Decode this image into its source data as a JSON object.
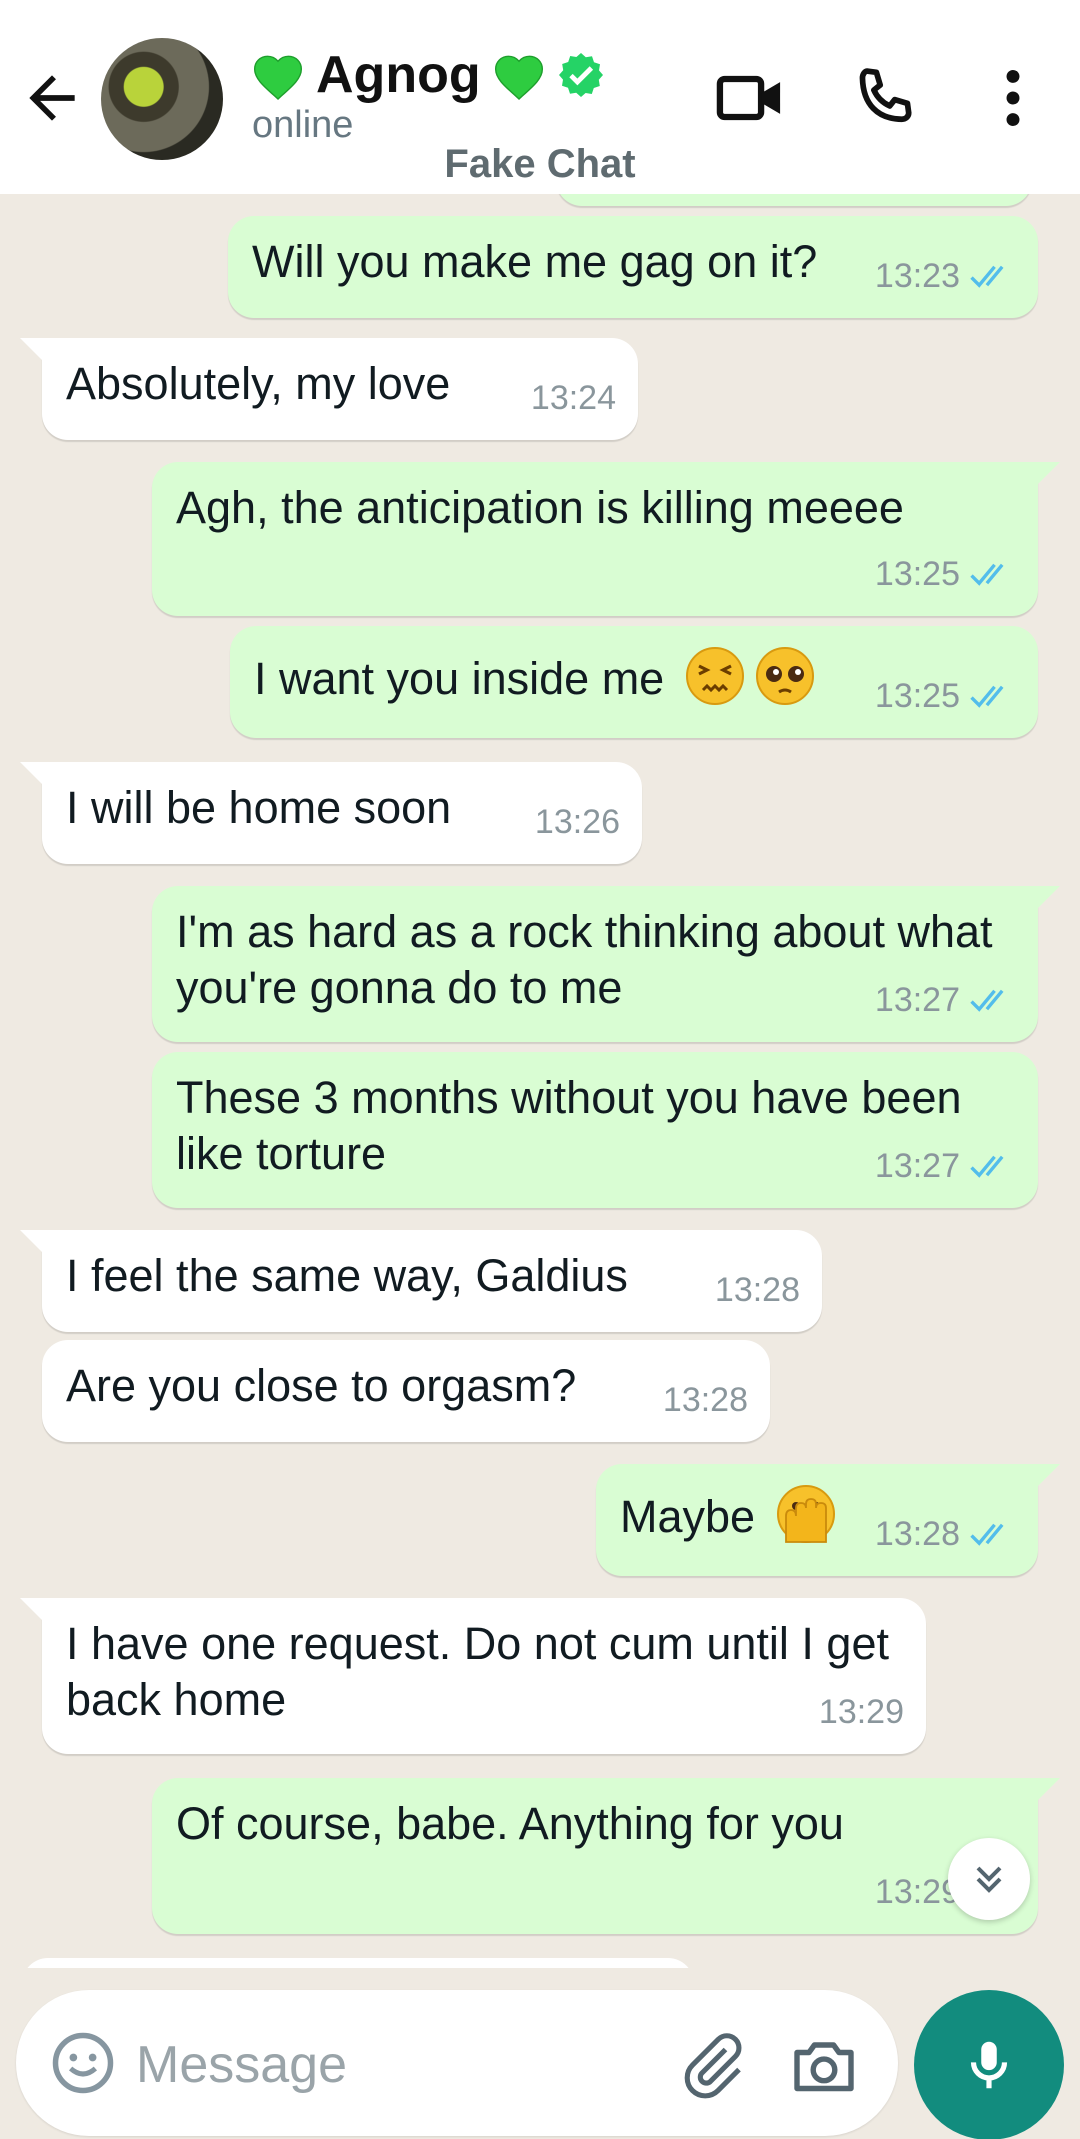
{
  "header": {
    "contact_name": "Agnog",
    "status": "online",
    "subtitle": "Fake Chat"
  },
  "messages": [
    {
      "dir": "out",
      "text": "Will you make me gag on it?",
      "time": "13:23",
      "read": true
    },
    {
      "dir": "in",
      "text": "Absolutely, my love",
      "time": "13:24"
    },
    {
      "dir": "out",
      "text": "Agh, the anticipation is killing meeee",
      "time": "13:25",
      "read": true
    },
    {
      "dir": "out",
      "text": "I want you inside me",
      "emojis": [
        "confounded-face",
        "pleading-face"
      ],
      "time": "13:25",
      "read": true
    },
    {
      "dir": "in",
      "text": "I will be home soon",
      "time": "13:26"
    },
    {
      "dir": "out",
      "text": "I'm as hard as a rock thinking about what you're gonna do to me",
      "time": "13:27",
      "read": true
    },
    {
      "dir": "out",
      "text": "These 3 months without you have been like torture",
      "time": "13:27",
      "read": true
    },
    {
      "dir": "in",
      "text": "I feel the same way, Galdius",
      "time": "13:28"
    },
    {
      "dir": "in",
      "text": "Are you close to orgasm?",
      "time": "13:28"
    },
    {
      "dir": "out",
      "text": "Maybe",
      "emojis": [
        "face-with-open-eyes-and-hand-over-mouth"
      ],
      "time": "13:28",
      "read": true
    },
    {
      "dir": "in",
      "text": "I have one request. Do not cum until I get back home",
      "time": "13:29"
    },
    {
      "dir": "out",
      "text": "Of course, babe. Anything for you",
      "time": "13:29",
      "read": true
    }
  ],
  "composer": {
    "placeholder": "Message"
  },
  "colors": {
    "outgoing_bubble": "#d9fdd3",
    "incoming_bubble": "#ffffff",
    "chat_background": "#efeae2",
    "read_ticks": "#53bdeb",
    "mic_button": "#128c7e",
    "verified_badge": "#25d366"
  },
  "icons": [
    "back-arrow-icon",
    "green-heart-icon",
    "verified-badge-icon",
    "video-call-icon",
    "phone-icon",
    "more-vert-icon",
    "double-check-icon",
    "scroll-down-icon",
    "emoji-icon",
    "attach-icon",
    "camera-icon",
    "mic-icon"
  ]
}
